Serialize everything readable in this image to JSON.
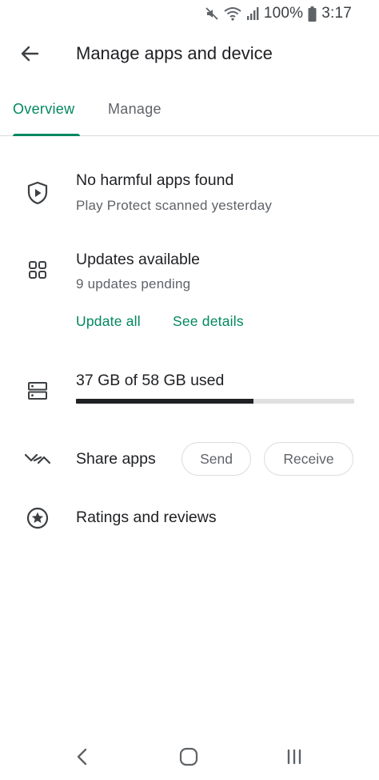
{
  "status_bar": {
    "battery_percent_text": "100%",
    "time": "3:17",
    "icons": [
      "mute-icon",
      "wifi-icon",
      "signal-icon",
      "battery-icon"
    ]
  },
  "app_bar": {
    "title": "Manage apps and device",
    "back_icon": "arrow-back-icon"
  },
  "tabs": [
    {
      "label": "Overview",
      "selected": true
    },
    {
      "label": "Manage",
      "selected": false
    }
  ],
  "protect": {
    "icon": "shield-play-icon",
    "title": "No harmful apps found",
    "subtitle": "Play Protect scanned yesterday"
  },
  "updates": {
    "icon": "apps-grid-icon",
    "title": "Updates available",
    "subtitle": "9 updates pending",
    "update_all_label": "Update all",
    "see_details_label": "See details"
  },
  "storage": {
    "icon": "storage-icon",
    "title": "37 GB of 58 GB used",
    "used_gb": 37,
    "total_gb": 58
  },
  "share": {
    "icon": "share-apps-icon",
    "title": "Share apps",
    "send_label": "Send",
    "receive_label": "Receive"
  },
  "ratings": {
    "icon": "star-circle-icon",
    "title": "Ratings and reviews"
  },
  "nav_bar": {
    "icons": [
      "nav-back-icon",
      "nav-home-icon",
      "nav-recents-icon"
    ]
  },
  "colors": {
    "accent": "#01875f",
    "text_primary": "#202124",
    "text_secondary": "#5f6368",
    "divider": "#dadce0"
  }
}
